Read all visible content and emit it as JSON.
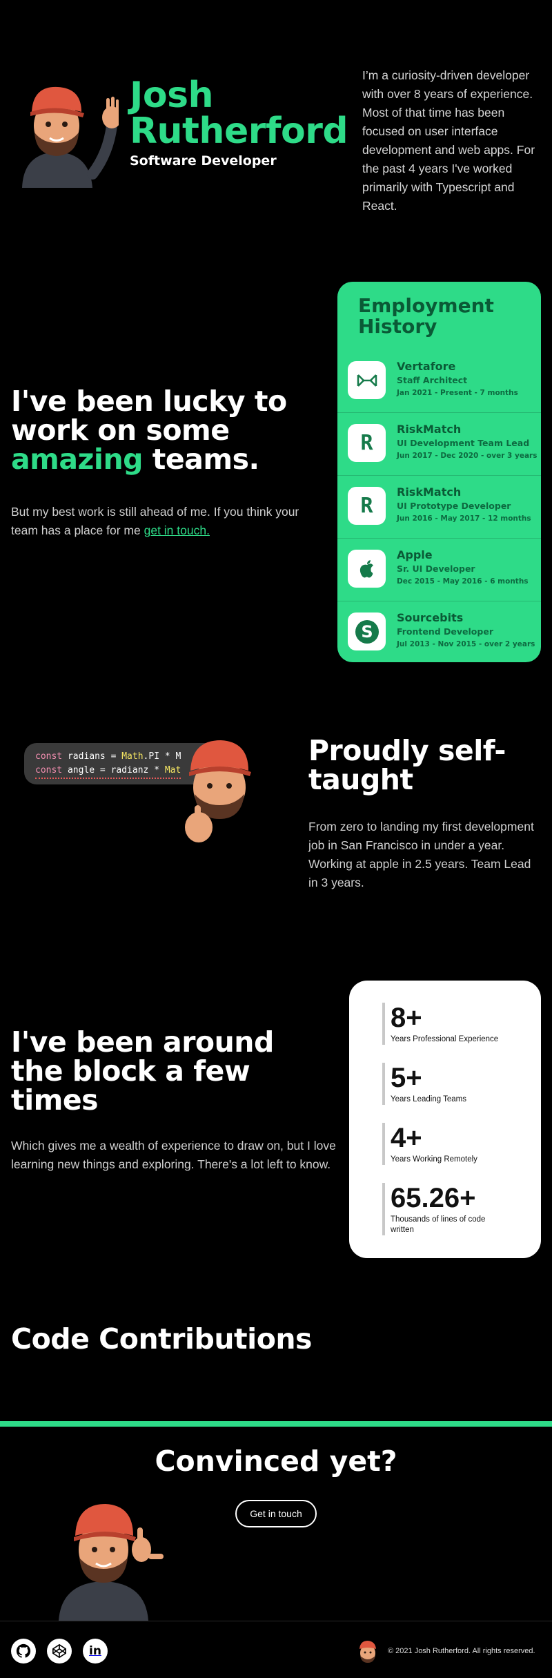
{
  "hero": {
    "name": "Josh Rutherford",
    "role": "Software Developer",
    "bio": "I’m a curiosity-driven developer with over 8 years of experience. Most of that time has been focused on user interface development and web apps. For the past 4 years I've worked primarily with Typescript and React."
  },
  "employment": {
    "heading_line1": "I've been lucky to work on some",
    "heading_highlight": "amazing",
    "heading_end": "teams.",
    "sub_text": "But my best work is still ahead of me. If you think your team has a place for me",
    "sub_link": "get in touch.",
    "card_title": "Employment History",
    "jobs": [
      {
        "company": "Vertafore",
        "role": "Staff Architect",
        "dates": "Jan 2021 - Present - 7 months",
        "logo": "vertafore-logo"
      },
      {
        "company": "RiskMatch",
        "role": "UI Development Team Lead",
        "dates": "Jun 2017 - Dec 2020 - over 3 years",
        "logo": "riskmatch-logo"
      },
      {
        "company": "RiskMatch",
        "role": "UI Prototype Developer",
        "dates": "Jun 2016 - May 2017 - 12 months",
        "logo": "riskmatch-logo"
      },
      {
        "company": "Apple",
        "role": "Sr. UI Developer",
        "dates": "Dec 2015 - May 2016 - 6 months",
        "logo": "apple-logo"
      },
      {
        "company": "Sourcebits",
        "role": "Frontend Developer",
        "dates": "Jul 2013 - Nov 2015 - over 2 years",
        "logo": "sourcebits-logo"
      }
    ]
  },
  "self_taught": {
    "heading": "Proudly self-taught",
    "sub": "From zero to landing my first development job in San Francisco in under a year. Working at apple in 2.5 years. Team Lead in 3 years.",
    "code_line1_kw": "const",
    "code_line1_rest": " radians = ",
    "code_line1_fn": "Math",
    "code_line1_end": ".PI * M",
    "code_line2_kw": "const",
    "code_line2_rest": " angle = radianz * ",
    "code_line2_fn": "Mat"
  },
  "stats": {
    "heading": "I've been around the block a few times",
    "sub": "Which gives me a wealth of experience to draw on, but I love learning new things and exploring. There's a lot left to know.",
    "items": [
      {
        "value": "8+",
        "label": "Years Professional Experience"
      },
      {
        "value": "5+",
        "label": "Years Leading Teams"
      },
      {
        "value": "4+",
        "label": "Years Working Remotely"
      },
      {
        "value": "65.26+",
        "label": "Thousands of lines of code written"
      }
    ]
  },
  "contributions": {
    "heading": "Code Contributions"
  },
  "cta": {
    "heading": "Convinced yet?",
    "button": "Get in touch"
  },
  "footer": {
    "copyright": "© 2021 Josh Rutherford. All rights reserved.",
    "social": [
      "github-icon",
      "codepen-icon",
      "linkedin-icon"
    ]
  },
  "colors": {
    "accent": "#2edb88",
    "background": "#000000",
    "card_text": "#0a5a36"
  }
}
